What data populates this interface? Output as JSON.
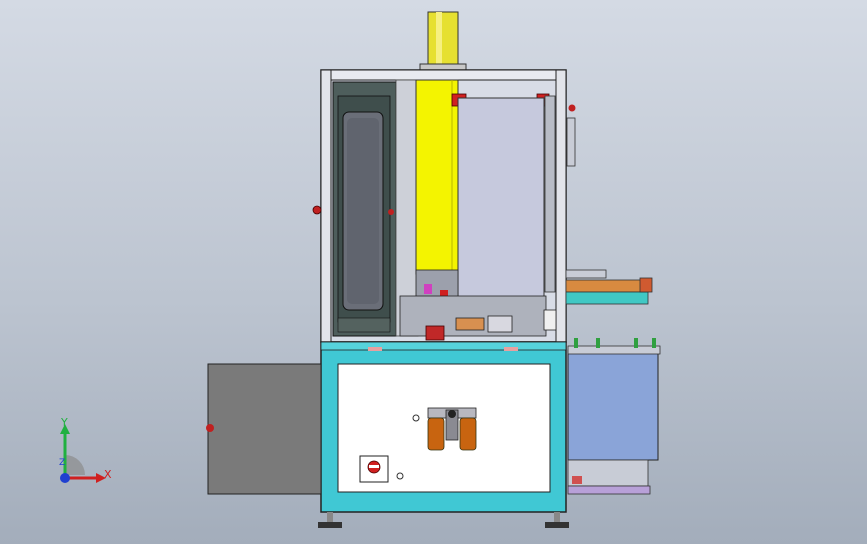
{
  "view": {
    "background_top": "#d4dae4",
    "background_bottom": "#a3adbb"
  },
  "colors": {
    "frame_outline": "#1a1a1a",
    "cylinder_yellow": "#e8e030",
    "yellow_panel": "#f4f400",
    "cover_lavender": "#c4c8dc",
    "door_dark": "#4a5a58",
    "window_gray": "#6a6e78",
    "base_cyan": "#40c8d4",
    "side_box_gray": "#7a7a7a",
    "side_box_blue": "#8aa4d8",
    "conveyor_orange": "#d88a40",
    "conveyor_cyan": "#40c8c4",
    "filter_orange": "#c86410",
    "stop_red": "#d02020"
  },
  "triad": {
    "x_label": "X",
    "y_label": "Y",
    "z_label": "Z",
    "x_color": "#d02020",
    "y_color": "#20b040",
    "z_color": "#2040d0"
  }
}
